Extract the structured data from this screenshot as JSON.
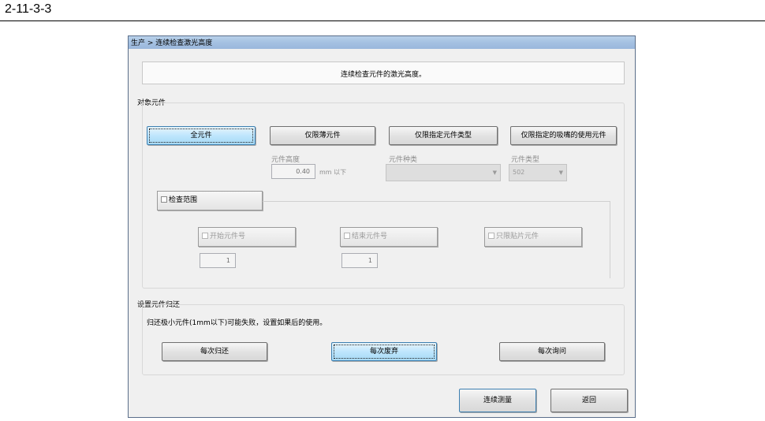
{
  "document": {
    "section_number": "2-11-3-3"
  },
  "window": {
    "title": "生产 > 连续检查激光高度"
  },
  "banner": {
    "text": "连续检查元件的激光高度。"
  },
  "target_parts": {
    "group_label": "对象元件",
    "buttons": [
      {
        "label": "全元件",
        "active": true
      },
      {
        "label": "仅限薄元件",
        "active": false
      },
      {
        "label": "仅限指定元件类型",
        "active": false
      },
      {
        "label": "仅限指定的吸嘴的使用元件",
        "active": false
      }
    ],
    "part_height": {
      "label": "元件高度",
      "value": "0.40",
      "unit": "mm 以下"
    },
    "part_kind": {
      "label": "元件种类",
      "value": ""
    },
    "part_type": {
      "label": "元件类型",
      "value": "502"
    }
  },
  "check_range": {
    "toggle_label": "检查范围",
    "start_part": {
      "label": "开始元件号",
      "value": "1"
    },
    "end_part": {
      "label": "结束元件号",
      "value": "1"
    },
    "mount_only": {
      "label": "只限贴片元件"
    }
  },
  "return_setting": {
    "group_label": "设置元件归还",
    "note": "归还极小元件(1mm以下)可能失败，设置如果后的使用。",
    "buttons": [
      {
        "label": "每次归还",
        "active": false
      },
      {
        "label": "每次废弃",
        "active": true
      },
      {
        "label": "每次询问",
        "active": false
      }
    ]
  },
  "footer": {
    "continue_label": "连续测量",
    "back_label": "返回"
  },
  "colors": {
    "active_button": "#bee6fd",
    "titlebar": "#a6c2e2",
    "dialog_bg": "#f0f0f0"
  }
}
